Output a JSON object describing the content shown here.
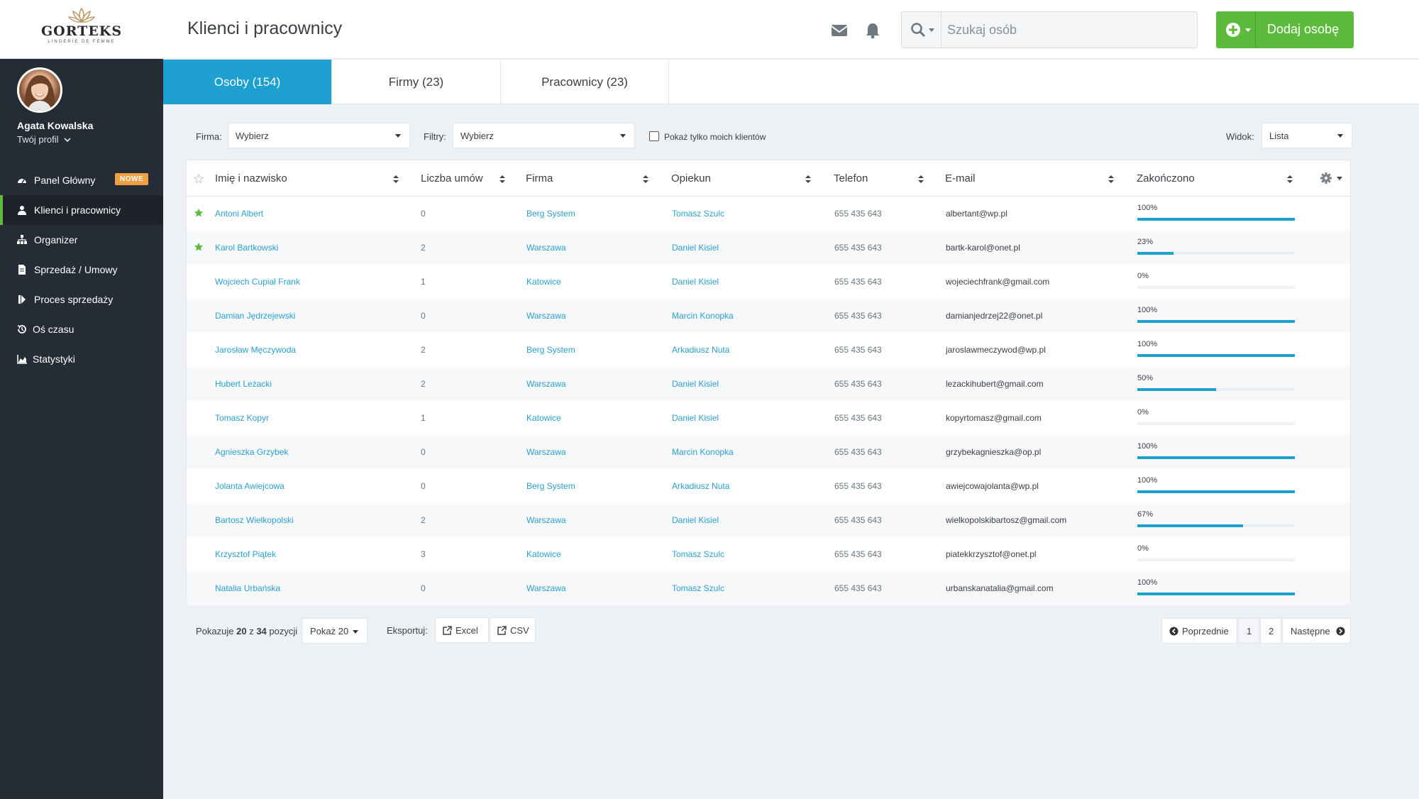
{
  "brand": {
    "name": "GORTEKS",
    "tagline": "LINGERIE DE FEMME"
  },
  "header": {
    "title": "Klienci i pracownicy",
    "search_placeholder": "Szukaj osób",
    "add_button": "Dodaj osobę"
  },
  "user": {
    "name": "Agata Kowalska",
    "profile_link": "Twój profil"
  },
  "sidebar": {
    "items": [
      {
        "label": "Panel Główny",
        "badge": "NOWE",
        "icon": "dashboard-icon"
      },
      {
        "label": "Klienci i pracownicy",
        "icon": "user-icon",
        "active": true
      },
      {
        "label": "Organizer",
        "icon": "sitemap-icon"
      },
      {
        "label": "Sprzedaż / Umowy",
        "icon": "document-icon"
      },
      {
        "label": "Proces sprzedaży",
        "icon": "step-forward-icon"
      },
      {
        "label": "Oś czasu",
        "icon": "history-icon"
      },
      {
        "label": "Statystyki",
        "icon": "area-chart-icon"
      }
    ]
  },
  "tabs": [
    {
      "label": "Osoby (154)",
      "active": true
    },
    {
      "label": "Firmy (23)"
    },
    {
      "label": "Pracownicy (23)"
    }
  ],
  "filters": {
    "firma_label": "Firma:",
    "firma_value": "Wybierz",
    "filtry_label": "Filtry:",
    "filtry_value": "Wybierz",
    "only_mine_label": "Pokaż tylko moich klientów",
    "view_label": "Widok:",
    "view_value": "Lista"
  },
  "table": {
    "columns": [
      "Imię i nazwisko",
      "Liczba umów",
      "Firma",
      "Opiekun",
      "Telefon",
      "E-mail",
      "Zakończono"
    ],
    "rows": [
      {
        "starred": true,
        "name": "Antoni Albert",
        "contracts": "0",
        "company": "Berg System",
        "manager": "Tomasz Szulc",
        "phone": "655 435 643",
        "email": "albertant@wp.pl",
        "done": 100,
        "done_label": "100%"
      },
      {
        "starred": true,
        "name": "Karol Bartkowski",
        "contracts": "2",
        "company": "Warszawa",
        "manager": "Daniel Kisiel",
        "phone": "655 435 643",
        "email": "bartk-karol@onet.pl",
        "done": 23,
        "done_label": "23%"
      },
      {
        "starred": false,
        "name": "Wojciech Cupiał Frank",
        "contracts": "1",
        "company": "Katowice",
        "manager": "Daniel Kisiel",
        "phone": "655 435 643",
        "email": "wojeciechfrank@gmail.com",
        "done": 0,
        "done_label": "0%"
      },
      {
        "starred": false,
        "name": "Damian Jędrzejewski",
        "contracts": "0",
        "company": "Warszawa",
        "manager": "Marcin Konopka",
        "phone": "655 435 643",
        "email": "damianjedrzej22@onet.pl",
        "done": 100,
        "done_label": "100%"
      },
      {
        "starred": false,
        "name": "Jarosław Męczywoda",
        "contracts": "2",
        "company": "Berg System",
        "manager": "Arkadiusz Nuta",
        "phone": "655 435 643",
        "email": "jaroslawmeczywod@wp.pl",
        "done": 100,
        "done_label": "100%"
      },
      {
        "starred": false,
        "name": "Hubert Leżacki",
        "contracts": "2",
        "company": "Warszawa",
        "manager": "Daniel Kisiel",
        "phone": "655 435 643",
        "email": "lezackihubert@gmail.com",
        "done": 50,
        "done_label": "50%"
      },
      {
        "starred": false,
        "name": "Tomasz Kopyr",
        "contracts": "1",
        "company": "Katowice",
        "manager": "Daniel Kisiel",
        "phone": "655 435 643",
        "email": "kopyrtomasz@gmail.com",
        "done": 0,
        "done_label": "0%"
      },
      {
        "starred": false,
        "name": "Agnieszka Grzybek",
        "contracts": "0",
        "company": "Warszawa",
        "manager": "Marcin Konopka",
        "phone": "655 435 643",
        "email": "grzybekagnieszka@op.pl",
        "done": 100,
        "done_label": "100%"
      },
      {
        "starred": false,
        "name": "Jolanta Awiejcowa",
        "contracts": "0",
        "company": "Berg System",
        "manager": "Arkadiusz Nuta",
        "phone": "655 435 643",
        "email": "awiejcowajolanta@wp.pl",
        "done": 100,
        "done_label": "100%"
      },
      {
        "starred": false,
        "name": "Bartosz Wielkopolski",
        "contracts": "2",
        "company": "Warszawa",
        "manager": "Daniel Kisiel",
        "phone": "655 435 643",
        "email": "wielkopolskibartosz@gmail.com",
        "done": 67,
        "done_label": "67%"
      },
      {
        "starred": false,
        "name": "Krzysztof Piątek",
        "contracts": "3",
        "company": "Katowice",
        "manager": "Tomasz Szulc",
        "phone": "655 435 643",
        "email": "piatekkrzysztof@onet.pl",
        "done": 0,
        "done_label": "0%"
      },
      {
        "starred": false,
        "name": "Natalia Urbańska",
        "contracts": "0",
        "company": "Warszawa",
        "manager": "Tomasz Szulc",
        "phone": "655 435 643",
        "email": "urbanskanatalia@gmail.com",
        "done": 100,
        "done_label": "100%"
      }
    ]
  },
  "footer": {
    "showing_prefix": "Pokazuje",
    "showing_count": "20",
    "showing_mid": "z",
    "showing_total": "34",
    "showing_suffix": "pozycji",
    "page_size": "Pokaż 20",
    "export_label": "Eksportuj:",
    "export_excel": "Excel",
    "export_csv": "CSV",
    "prev": "Poprzednie",
    "pages": [
      "1",
      "2"
    ],
    "next": "Następne"
  },
  "colors": {
    "accent": "#1d9fcf",
    "primary_action": "#5cba3c",
    "sidebar_bg": "#262c35",
    "badge": "#f0a044",
    "star": "#5cba3c"
  }
}
